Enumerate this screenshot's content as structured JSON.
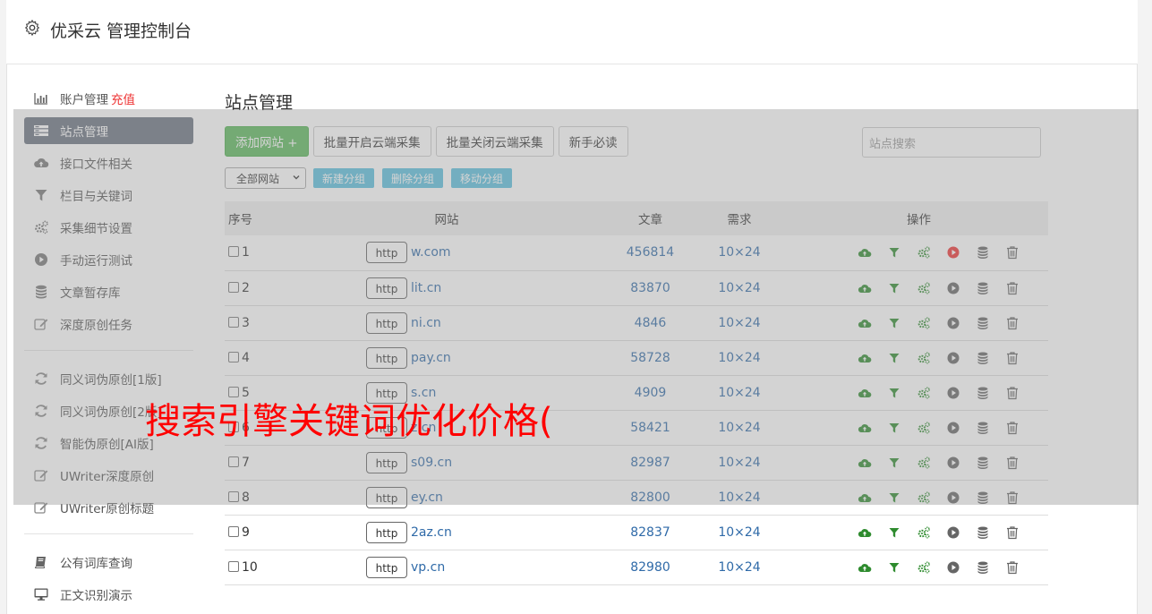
{
  "header": {
    "title": "优采云 管理控制台"
  },
  "sidebar": {
    "group1": [
      {
        "label": "账户管理",
        "extra": "充值",
        "icon": "bar-chart-icon"
      },
      {
        "label": "站点管理",
        "icon": "server-list-icon",
        "active": true
      },
      {
        "label": "接口文件相关",
        "icon": "cloud-upload-icon"
      },
      {
        "label": "栏目与关键词",
        "icon": "filter-icon"
      },
      {
        "label": "采集细节设置",
        "icon": "gears-icon"
      },
      {
        "label": "手动运行测试",
        "icon": "play-circle-icon"
      },
      {
        "label": "文章暂存库",
        "icon": "database-icon"
      },
      {
        "label": "深度原创任务",
        "icon": "edit-icon"
      }
    ],
    "group2": [
      {
        "label": "同义词伪原创[1版]",
        "icon": "refresh-icon"
      },
      {
        "label": "同义词伪原创[2版]",
        "icon": "refresh-icon"
      },
      {
        "label": "智能伪原创[AI版]",
        "icon": "refresh-icon"
      },
      {
        "label": "UWriter深度原创",
        "icon": "edit-icon"
      },
      {
        "label": "UWriter原创标题",
        "icon": "edit-icon"
      }
    ],
    "group3": [
      {
        "label": "公有词库查询",
        "icon": "book-icon"
      },
      {
        "label": "正文识别演示",
        "icon": "monitor-icon"
      }
    ]
  },
  "main": {
    "title": "站点管理",
    "add_site": "添加网站 +",
    "batch_on": "批量开启云端采集",
    "batch_off": "批量关闭云端采集",
    "guide": "新手必读",
    "search_placeholder": "站点搜索",
    "group_select": "全部网站",
    "new_group": "新建分组",
    "delete_group": "删除分组",
    "move_group": "移动分组"
  },
  "table": {
    "columns": [
      "序号",
      "网站",
      "文章",
      "需求",
      "操作"
    ],
    "rows": [
      {
        "no": "1",
        "http": "http",
        "site": "w.com",
        "articles": "456814",
        "demand": "10×24",
        "running": true
      },
      {
        "no": "2",
        "http": "http",
        "site": "lit.cn",
        "articles": "83870",
        "demand": "10×24",
        "running": false
      },
      {
        "no": "3",
        "http": "http",
        "site": "ni.cn",
        "articles": "4846",
        "demand": "10×24",
        "running": false
      },
      {
        "no": "4",
        "http": "http",
        "site": "pay.cn",
        "articles": "58728",
        "demand": "10×24",
        "running": false
      },
      {
        "no": "5",
        "http": "http",
        "site": "s.cn",
        "articles": "4909",
        "demand": "10×24",
        "running": false
      },
      {
        "no": "6",
        "http": "http",
        "site": "z.cn",
        "articles": "58421",
        "demand": "10×24",
        "running": false
      },
      {
        "no": "7",
        "http": "http",
        "site": "s09.cn",
        "articles": "82987",
        "demand": "10×24",
        "running": false
      },
      {
        "no": "8",
        "http": "http",
        "site": "ey.cn",
        "articles": "82800",
        "demand": "10×24",
        "running": false
      },
      {
        "no": "9",
        "http": "http",
        "site": "2az.cn",
        "articles": "82837",
        "demand": "10×24",
        "running": false
      },
      {
        "no": "10",
        "http": "http",
        "site": "vp.cn",
        "articles": "82980",
        "demand": "10×24",
        "running": false
      }
    ]
  },
  "overlay_text": "搜索引擎关键词优化价格(",
  "colors": {
    "green": "#5cb85c",
    "icon_green": "#2e8b2e",
    "info": "#5bc0de",
    "active_nav": "#6a7280",
    "link": "#2f6aa8",
    "danger": "#e33"
  }
}
